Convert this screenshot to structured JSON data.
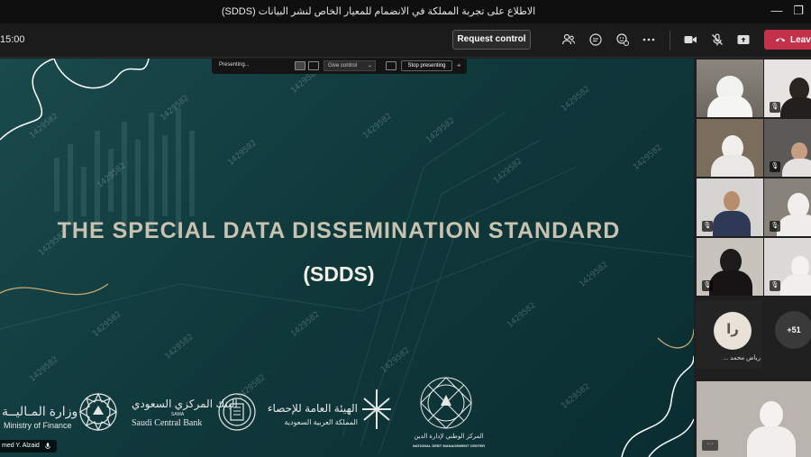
{
  "window": {
    "title": "الاطلاع على تجربة المملكة في الانضمام للمعيار الخاص لنشر البيانات (SDDS)",
    "minimize_glyph": "—",
    "restore_glyph": "❐"
  },
  "toolbar": {
    "timer": "15:00",
    "request_control_label": "Request control",
    "leave_label": "Leave",
    "icons": [
      "participants-icon",
      "chat-icon",
      "reactions-icon",
      "more-icon",
      "camera-icon",
      "mic-off-icon",
      "share-icon"
    ]
  },
  "presenting_bar": {
    "status": "Presenting...",
    "give_control_label": "Give control",
    "stop_label": "Stop presenting"
  },
  "slide": {
    "title": "THE SPECIAL DATA DISSEMINATION STANDARD",
    "subtitle": "(SDDS)",
    "watermark": "1429582",
    "logos": {
      "mof_ar": "وزارة المـاليــة",
      "mof_en": "Ministry of Finance",
      "sama_ar": "البنك المركزي السعودي",
      "sama_abbr": "SAMA",
      "sama_en": "Saudi Central Bank",
      "gastat_ar1": "الهيئة العامة للإحصاء",
      "gastat_ar2": "المملكة العربية السعودية",
      "ndmc_ar": "المركز الوطني لإدارة الدين",
      "ndmc_en": "NATIONAL DEBT MANAGEMENT CENTER"
    }
  },
  "presenter": {
    "name": "med Y. Alzaid"
  },
  "gallery": {
    "avatar_initials": "را",
    "avatar_name": "رياض محمد ...",
    "more_count": "+51"
  },
  "colors": {
    "leave": "#c4314b",
    "active_speaker": "#8b8cf0",
    "slide_bg": "#10393c"
  }
}
